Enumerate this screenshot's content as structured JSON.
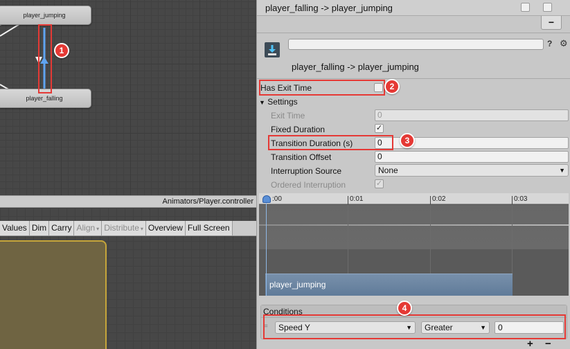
{
  "graph": {
    "state_top": "player_jumping",
    "state_bottom": "player_falling",
    "path": "Animators/Player.controller"
  },
  "toolbar": {
    "values": "Values",
    "dim": "Dim",
    "carry": "Carry",
    "align": "Align",
    "distribute": "Distribute",
    "overview": "Overview",
    "fullscreen": "Full Screen",
    "caret": "▾"
  },
  "inspector": {
    "header_title": "player_falling -> player_jumping",
    "minus": "−",
    "subtitle": "player_falling -> player_jumping",
    "help": "?",
    "gear": "⚙",
    "has_exit_time": {
      "label": "Has Exit Time",
      "checked": false
    },
    "settings_label": "Settings",
    "settings_fold": "▼",
    "exit_time": {
      "label": "Exit Time",
      "value": "0"
    },
    "fixed_duration": {
      "label": "Fixed Duration",
      "check": "✓"
    },
    "transition_duration": {
      "label": "Transition Duration (s)",
      "value": "0"
    },
    "transition_offset": {
      "label": "Transition Offset",
      "value": "0"
    },
    "interruption_source": {
      "label": "Interruption Source",
      "value": "None"
    },
    "ordered_interruption": {
      "label": "Ordered Interruption",
      "check": "✓"
    },
    "dropdown_arrow": "▼"
  },
  "timeline": {
    "ticks": [
      ":00",
      "0:01",
      "0:02",
      "0:03"
    ],
    "clip": "player_jumping"
  },
  "conditions": {
    "header": "Conditions",
    "handle": "=",
    "parameter": "Speed Y",
    "mode": "Greater",
    "value": "0",
    "plus": "+",
    "minus": "−"
  },
  "annotations": {
    "b1": "1",
    "b2": "2",
    "b3": "3",
    "b4": "4"
  },
  "colors": {
    "highlight": "#e53935",
    "transition_arrow": "#5fa4f0"
  }
}
